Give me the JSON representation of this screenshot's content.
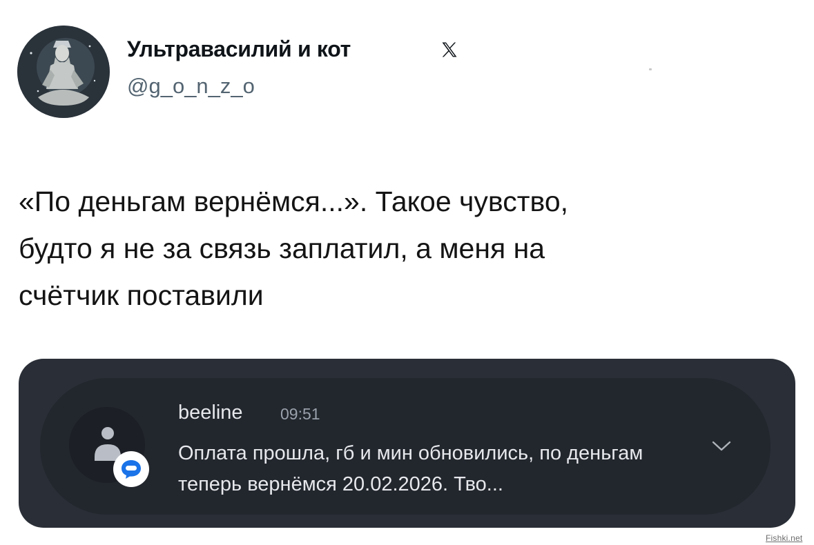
{
  "tweet": {
    "author_name": "Ультравасилий и кот",
    "author_handle": "@g_o_n_z_o",
    "text": "«По деньгам вернёмся...». Такое чувство,\nбудто я не за связь заплатил, а меня на\nсчётчик поставили"
  },
  "notification": {
    "sender": "beeline",
    "time": "09:51",
    "message": "Оплата прошла, гб и мин обновились, по деньгам теперь вернёмся  20.02.2026. Тво..."
  },
  "watermark": "Fishki.net",
  "icons": {
    "platform": "x-logo-icon",
    "expand": "chevron-down-icon",
    "contact": "contact-icon",
    "app_badge": "messages-app-icon"
  },
  "colors": {
    "background": "#ffffff",
    "handle": "#536471",
    "notification_card": "#2a2f37",
    "notification_inner": "#22262d",
    "badge_blue": "#1a73e8"
  }
}
